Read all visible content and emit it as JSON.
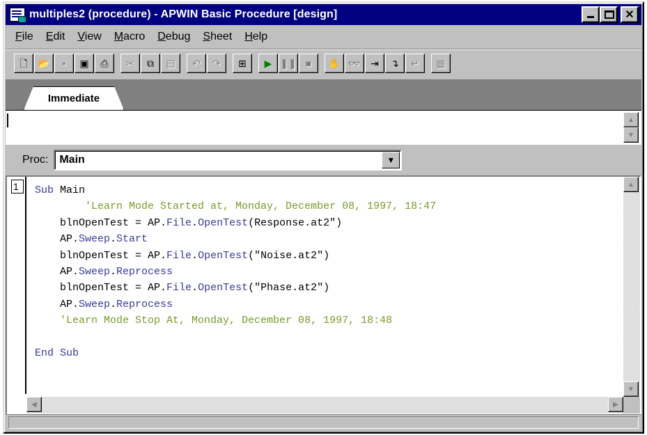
{
  "window": {
    "title": "multiples2 (procedure) - APWIN Basic Procedure [design]"
  },
  "menu": [
    {
      "label": "File",
      "key": "F",
      "rest": "ile"
    },
    {
      "label": "Edit",
      "key": "E",
      "rest": "dit"
    },
    {
      "label": "View",
      "key": "V",
      "rest": "iew"
    },
    {
      "label": "Macro",
      "key": "M",
      "rest": "acro"
    },
    {
      "label": "Debug",
      "key": "D",
      "rest": "ebug"
    },
    {
      "label": "Sheet",
      "key": "S",
      "rest": "heet"
    },
    {
      "label": "Help",
      "key": "H",
      "rest": "elp"
    }
  ],
  "toolbar": {
    "icons": [
      "new-icon",
      "open-icon",
      "save-icon",
      "save-all-icon",
      "print-icon",
      "cut-icon",
      "copy-icon",
      "paste-icon",
      "undo-icon",
      "redo-icon",
      "dialog-editor-icon",
      "run-icon",
      "pause-icon",
      "stop-icon",
      "toggle-breakpoint-icon",
      "quick-watch-icon",
      "step-into-icon",
      "step-over-icon",
      "step-out-icon",
      "sheet-icon"
    ]
  },
  "tabs": {
    "immediate_label": "Immediate"
  },
  "proc": {
    "label": "Proc:",
    "value": "Main"
  },
  "editor": {
    "line_number": "1",
    "lines": [
      {
        "parts": [
          {
            "t": "Sub",
            "c": "kw"
          },
          {
            "t": " Main",
            "c": ""
          }
        ]
      },
      {
        "parts": [
          {
            "t": "        'Learn Mode Started at, Monday, December 08, 1997, 18:47",
            "c": "cm"
          }
        ]
      },
      {
        "parts": [
          {
            "t": "    blnOpenTest = AP.",
            "c": ""
          },
          {
            "t": "File",
            "c": "obj"
          },
          {
            "t": ".",
            "c": ""
          },
          {
            "t": "OpenTest",
            "c": "obj"
          },
          {
            "t": "(Response.at2\")",
            "c": ""
          }
        ]
      },
      {
        "parts": [
          {
            "t": "    AP.",
            "c": ""
          },
          {
            "t": "Sweep",
            "c": "obj"
          },
          {
            "t": ".",
            "c": ""
          },
          {
            "t": "Start",
            "c": "obj"
          }
        ]
      },
      {
        "parts": [
          {
            "t": "    blnOpenTest = AP.",
            "c": ""
          },
          {
            "t": "File",
            "c": "obj"
          },
          {
            "t": ".",
            "c": ""
          },
          {
            "t": "OpenTest",
            "c": "obj"
          },
          {
            "t": "(\"Noise.at2\")",
            "c": ""
          }
        ]
      },
      {
        "parts": [
          {
            "t": "    AP.",
            "c": ""
          },
          {
            "t": "Sweep",
            "c": "obj"
          },
          {
            "t": ".",
            "c": ""
          },
          {
            "t": "Reprocess",
            "c": "obj"
          }
        ]
      },
      {
        "parts": [
          {
            "t": "    blnOpenTest = AP.",
            "c": ""
          },
          {
            "t": "File",
            "c": "obj"
          },
          {
            "t": ".",
            "c": ""
          },
          {
            "t": "OpenTest",
            "c": "obj"
          },
          {
            "t": "(\"Phase.at2\")",
            "c": ""
          }
        ]
      },
      {
        "parts": [
          {
            "t": "    AP.",
            "c": ""
          },
          {
            "t": "Sweep",
            "c": "obj"
          },
          {
            "t": ".",
            "c": ""
          },
          {
            "t": "Reprocess",
            "c": "obj"
          }
        ]
      },
      {
        "parts": [
          {
            "t": "    'Learn Mode Stop At, Monday, December 08, 1997, 18:48",
            "c": "cm"
          }
        ]
      },
      {
        "parts": [
          {
            "t": "",
            "c": ""
          }
        ]
      },
      {
        "parts": [
          {
            "t": "End Sub",
            "c": "kw"
          }
        ]
      }
    ]
  },
  "colors": {
    "titlebar": "#000080",
    "keyword": "#3a3a9a",
    "comment": "#7a9a2a"
  }
}
